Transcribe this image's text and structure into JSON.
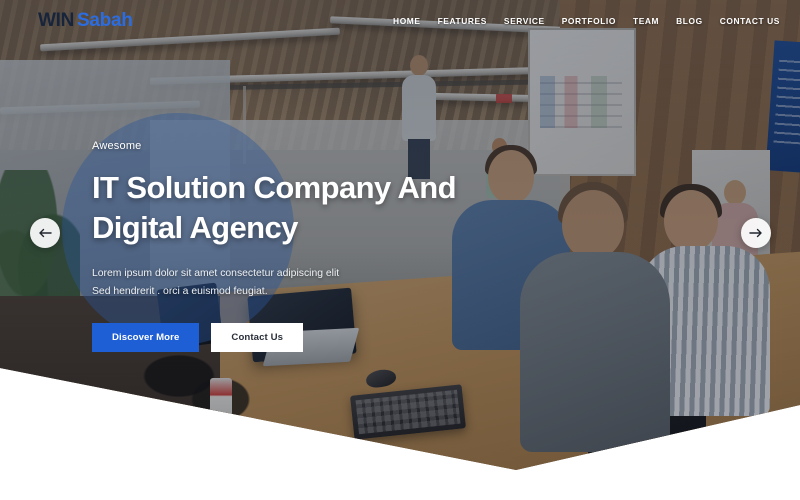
{
  "site": {
    "logo": {
      "part1": "WIN",
      "part2": "Sabah"
    },
    "nav": [
      {
        "label": "HOME",
        "name": "nav-item-home"
      },
      {
        "label": "FEATURES",
        "name": "nav-item-features"
      },
      {
        "label": "SERVICE",
        "name": "nav-item-service"
      },
      {
        "label": "PORTFOLIO",
        "name": "nav-item-portfolio"
      },
      {
        "label": "TEAM",
        "name": "nav-item-team"
      },
      {
        "label": "BLOG",
        "name": "nav-item-blog"
      },
      {
        "label": "CONTACT US",
        "name": "nav-item-contact-us"
      }
    ]
  },
  "hero": {
    "eyebrow": "Awesome",
    "headline_line1": "IT Solution Company And",
    "headline_line2": "Digital Agency",
    "subcopy_line1": "Lorem ipsum dolor sit amet consectetur adipiscing elit",
    "subcopy_line2": "Sed hendrerit . orci a euismod feugiat.",
    "primary_button": "Discover More",
    "secondary_button": "Contact Us",
    "prev_icon": "arrow-left-icon",
    "next_icon": "arrow-right-icon"
  },
  "colors": {
    "accent_blue": "#1e5fd6",
    "logo_dark": "#16243c",
    "logo_blue": "#2b6de0",
    "overlay_circle": "rgba(44,86,152,.42)",
    "white": "#ffffff"
  }
}
